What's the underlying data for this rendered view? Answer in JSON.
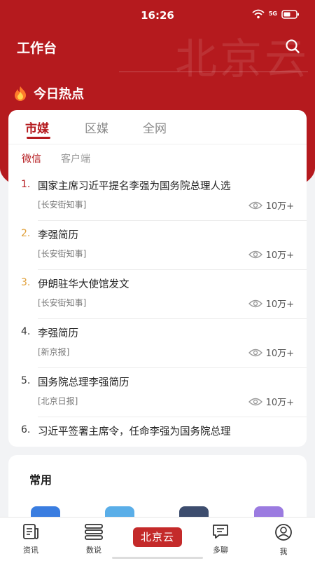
{
  "status_bar": {
    "time": "16:26",
    "signal_label": "5G"
  },
  "header": {
    "title": "工作台",
    "watermark": "北京云",
    "search_icon": "search-icon"
  },
  "hot": {
    "title": "今日热点",
    "icon": "flame-icon"
  },
  "tabs": [
    {
      "label": "市媒",
      "active": true
    },
    {
      "label": "区媒",
      "active": false
    },
    {
      "label": "全网",
      "active": false
    }
  ],
  "subtabs": [
    {
      "label": "微信",
      "active": true
    },
    {
      "label": "客户端",
      "active": false
    }
  ],
  "news": [
    {
      "rank": "1.",
      "title": "国家主席习近平提名李强为国务院总理人选",
      "source": "[长安街知事]",
      "views": "10万+"
    },
    {
      "rank": "2.",
      "title": "李强简历",
      "source": "[长安街知事]",
      "views": "10万+"
    },
    {
      "rank": "3.",
      "title": "伊朗驻华大使馆发文",
      "source": "[长安街知事]",
      "views": "10万+"
    },
    {
      "rank": "4.",
      "title": "李强简历",
      "source": "[新京报]",
      "views": "10万+"
    },
    {
      "rank": "5.",
      "title": "国务院总理李强简历",
      "source": "[北京日报]",
      "views": "10万+"
    },
    {
      "rank": "6.",
      "title": "习近平签署主席令，任命李强为国务院总理",
      "source": "",
      "views": ""
    }
  ],
  "rank_colors": [
    "#b51a1e",
    "#e0a03a",
    "#e0a03a",
    "#333333",
    "#333333",
    "#333333"
  ],
  "common": {
    "title": "常用",
    "icon_colors": [
      "#3a7de0",
      "#5aaee8",
      "#3d4d6e",
      "#9b7be0"
    ]
  },
  "bottom_nav": [
    {
      "label": "资讯",
      "icon": "news-icon"
    },
    {
      "label": "数说",
      "icon": "data-icon"
    },
    {
      "label": "北京云",
      "icon": "home-logo"
    },
    {
      "label": "多聊",
      "icon": "chat-icon"
    },
    {
      "label": "我",
      "icon": "profile-icon"
    }
  ],
  "colors": {
    "brand_red": "#b51a1e",
    "accent_orange": "#e0a03a"
  }
}
